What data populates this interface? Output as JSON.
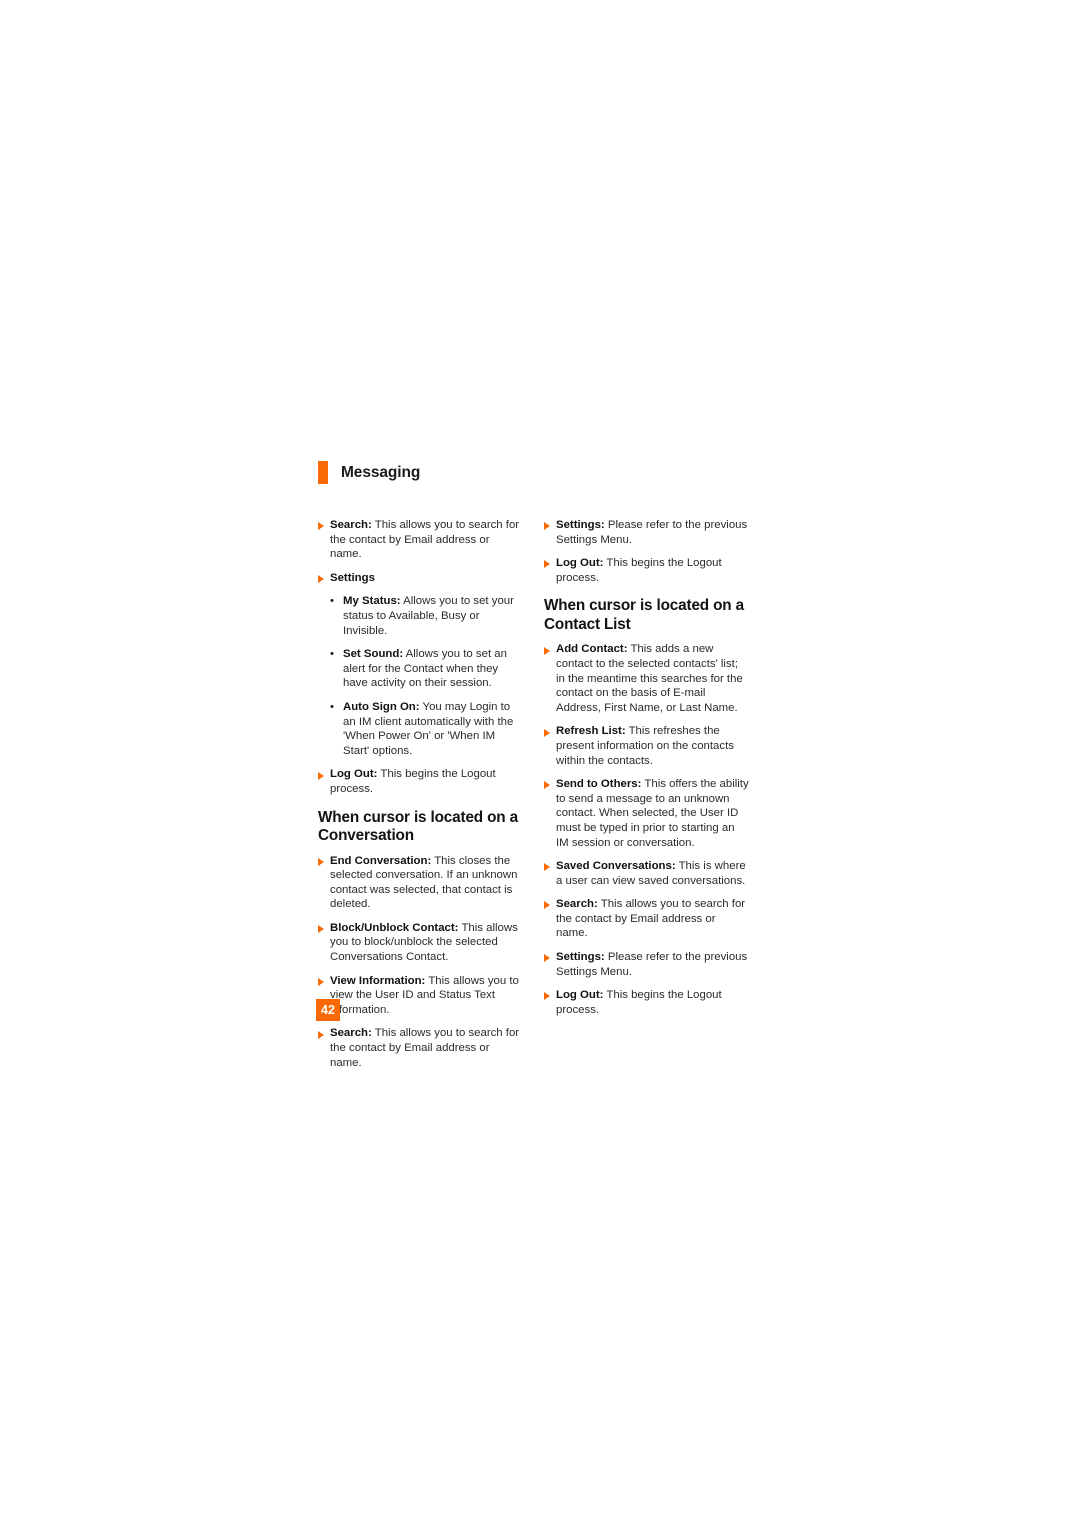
{
  "document": {
    "page_number": "42",
    "accent_color": "#F96A07",
    "text_color": "#2b2b2b",
    "background_color": "#ffffff"
  },
  "section_header": {
    "title": "Messaging"
  },
  "left_column": {
    "blocks": [
      {
        "type": "arrow",
        "term": "Search:",
        "text": " This allows you to search for the contact by Email address or name."
      },
      {
        "type": "arrow",
        "term": "Settings",
        "text": ""
      },
      {
        "type": "bullet",
        "term": "My Status:",
        "text": " Allows you to set your status to Available, Busy or Invisible."
      },
      {
        "type": "bullet",
        "term": "Set Sound:",
        "text": " Allows you to set an alert for the Contact when they have activity on their session."
      },
      {
        "type": "bullet",
        "term": "Auto Sign On:",
        "text": " You may Login to an IM client automatically with the 'When Power On' or 'When IM Start' options."
      },
      {
        "type": "arrow",
        "term": "Log Out:",
        "text": " This begins the Logout process."
      },
      {
        "type": "heading",
        "text": "When cursor is located on a Conversation"
      },
      {
        "type": "arrow",
        "term": "End Conversation:",
        "text": " This closes the selected conversation. If an unknown contact was selected, that contact is deleted."
      },
      {
        "type": "arrow",
        "term": "Block/Unblock Contact:",
        "text": " This allows you to block/unblock the selected Conversations Contact."
      },
      {
        "type": "arrow",
        "term": "View Information:",
        "text": " This allows you to view the User ID and Status Text information."
      },
      {
        "type": "arrow",
        "term": "Search:",
        "text": " This allows you to search for the contact by Email address or name."
      }
    ]
  },
  "right_column": {
    "blocks": [
      {
        "type": "arrow",
        "term": "Settings:",
        "text": " Please refer to the previous Settings Menu."
      },
      {
        "type": "arrow",
        "term": "Log Out:",
        "text": " This begins the Logout process."
      },
      {
        "type": "heading",
        "text": "When cursor is located on a Contact List"
      },
      {
        "type": "arrow",
        "term": "Add Contact:",
        "text": " This adds a new contact to the selected contacts' list; in the meantime this searches for the contact on the basis of E-mail Address, First Name, or Last Name."
      },
      {
        "type": "arrow",
        "term": "Refresh List:",
        "text": " This refreshes the present information on the contacts within the contacts."
      },
      {
        "type": "arrow",
        "term": "Send to Others:",
        "text": " This offers the ability to send a message to an unknown contact. When selected, the User ID must be typed in prior to starting an IM session or conversation."
      },
      {
        "type": "arrow",
        "term": "Saved Conversations:",
        "text": " This is where a user can view saved conversations."
      },
      {
        "type": "arrow",
        "term": "Search:",
        "text": " This allows you to search for the contact by Email address or name."
      },
      {
        "type": "arrow",
        "term": "Settings:",
        "text": " Please refer to the previous Settings Menu."
      },
      {
        "type": "arrow",
        "term": "Log Out:",
        "text": " This begins the Logout process."
      }
    ]
  }
}
